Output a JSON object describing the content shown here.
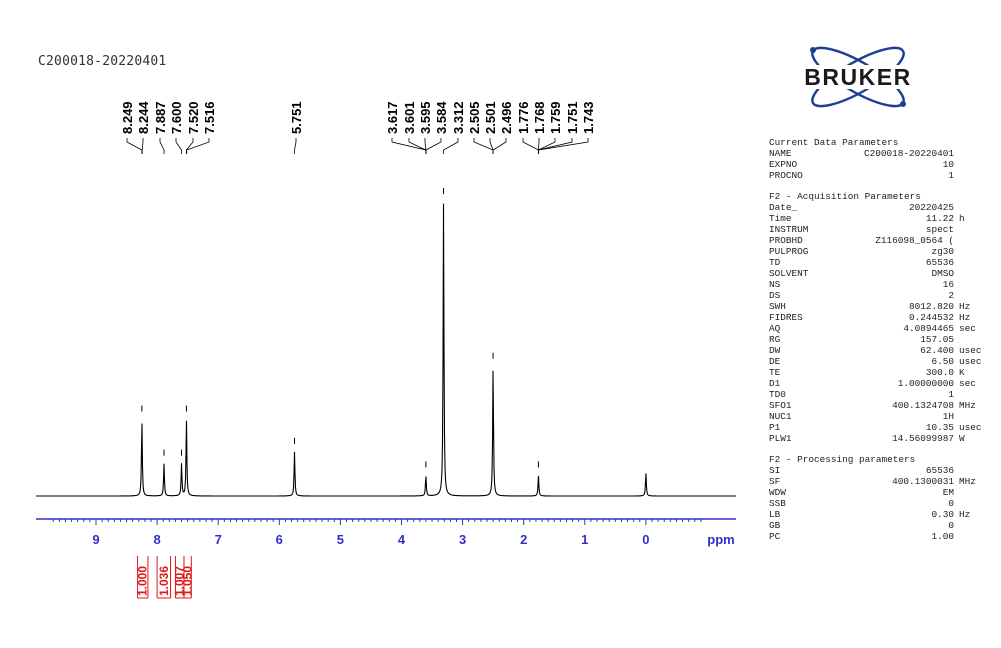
{
  "spectrum_title": "C200018-20220401",
  "logo_text": "BRUKER",
  "colors": {
    "trace": "#000000",
    "axis": "#3030c8",
    "integral": "#e01818",
    "text": "#222222"
  },
  "chart_data": {
    "type": "nmr-spectrum",
    "title": "C200018-20220401",
    "xlabel": "ppm",
    "xlim": [
      9.75,
      -1.0
    ],
    "x_reversed": true,
    "x_ticks": [
      9,
      8,
      7,
      6,
      5,
      4,
      3,
      2,
      1,
      0
    ],
    "peak_labels": [
      "8.249",
      "8.244",
      "7.887",
      "7.600",
      "7.520",
      "7.516",
      "5.751",
      "3.617",
      "3.601",
      "3.595",
      "3.584",
      "3.312",
      "2.505",
      "2.501",
      "2.496",
      "1.776",
      "1.768",
      "1.759",
      "1.751",
      "1.743"
    ],
    "peaks": [
      {
        "ppm": 8.249,
        "intensity": 0.26
      },
      {
        "ppm": 7.887,
        "intensity": 0.11
      },
      {
        "ppm": 7.6,
        "intensity": 0.11
      },
      {
        "ppm": 7.52,
        "intensity": 0.26
      },
      {
        "ppm": 5.751,
        "intensity": 0.15
      },
      {
        "ppm": 3.601,
        "intensity": 0.07
      },
      {
        "ppm": 3.312,
        "intensity": 1.0
      },
      {
        "ppm": 2.501,
        "intensity": 0.44
      },
      {
        "ppm": 1.759,
        "intensity": 0.07
      },
      {
        "ppm": 0.0,
        "intensity": 0.08
      }
    ],
    "integrals": [
      {
        "value": "1.000",
        "from": 8.32,
        "to": 8.15
      },
      {
        "value": "1.036",
        "from": 8.0,
        "to": 7.78
      },
      {
        "value": "1.007",
        "from": 7.7,
        "to": 7.56
      },
      {
        "value": "1.050",
        "from": 7.56,
        "to": 7.44
      }
    ]
  },
  "params": {
    "current": {
      "heading": "Current Data Parameters",
      "rows": [
        {
          "name": "NAME",
          "value": "C200018-20220401",
          "unit": ""
        },
        {
          "name": "EXPNO",
          "value": "10",
          "unit": ""
        },
        {
          "name": "PROCNO",
          "value": "1",
          "unit": ""
        }
      ]
    },
    "acquisition": {
      "heading": "F2 - Acquisition Parameters",
      "rows": [
        {
          "name": "Date_",
          "value": "20220425",
          "unit": ""
        },
        {
          "name": "Time",
          "value": "11.22",
          "unit": "h"
        },
        {
          "name": "INSTRUM",
          "value": "spect",
          "unit": ""
        },
        {
          "name": "PROBHD",
          "value": "Z116098_0564 (",
          "unit": ""
        },
        {
          "name": "PULPROG",
          "value": "zg30",
          "unit": ""
        },
        {
          "name": "TD",
          "value": "65536",
          "unit": ""
        },
        {
          "name": "SOLVENT",
          "value": "DMSO",
          "unit": ""
        },
        {
          "name": "NS",
          "value": "16",
          "unit": ""
        },
        {
          "name": "DS",
          "value": "2",
          "unit": ""
        },
        {
          "name": "SWH",
          "value": "8012.820",
          "unit": "Hz"
        },
        {
          "name": "FIDRES",
          "value": "0.244532",
          "unit": "Hz"
        },
        {
          "name": "AQ",
          "value": "4.0894465",
          "unit": "sec"
        },
        {
          "name": "RG",
          "value": "157.05",
          "unit": ""
        },
        {
          "name": "DW",
          "value": "62.400",
          "unit": "usec"
        },
        {
          "name": "DE",
          "value": "6.50",
          "unit": "usec"
        },
        {
          "name": "TE",
          "value": "300.0",
          "unit": "K"
        },
        {
          "name": "D1",
          "value": "1.00000000",
          "unit": "sec"
        },
        {
          "name": "TD0",
          "value": "1",
          "unit": ""
        },
        {
          "name": "SFO1",
          "value": "400.1324708",
          "unit": "MHz"
        },
        {
          "name": "NUC1",
          "value": "1H",
          "unit": ""
        },
        {
          "name": "P1",
          "value": "10.35",
          "unit": "usec"
        },
        {
          "name": "PLW1",
          "value": "14.56099987",
          "unit": "W"
        }
      ]
    },
    "processing": {
      "heading": "F2 - Processing parameters",
      "rows": [
        {
          "name": "SI",
          "value": "65536",
          "unit": ""
        },
        {
          "name": "SF",
          "value": "400.1300031",
          "unit": "MHz"
        },
        {
          "name": "WDW",
          "value": "EM",
          "unit": ""
        },
        {
          "name": "SSB",
          "value": "0",
          "unit": ""
        },
        {
          "name": "LB",
          "value": "0.30",
          "unit": "Hz"
        },
        {
          "name": "GB",
          "value": "0",
          "unit": ""
        },
        {
          "name": "PC",
          "value": "1.00",
          "unit": ""
        }
      ]
    }
  }
}
